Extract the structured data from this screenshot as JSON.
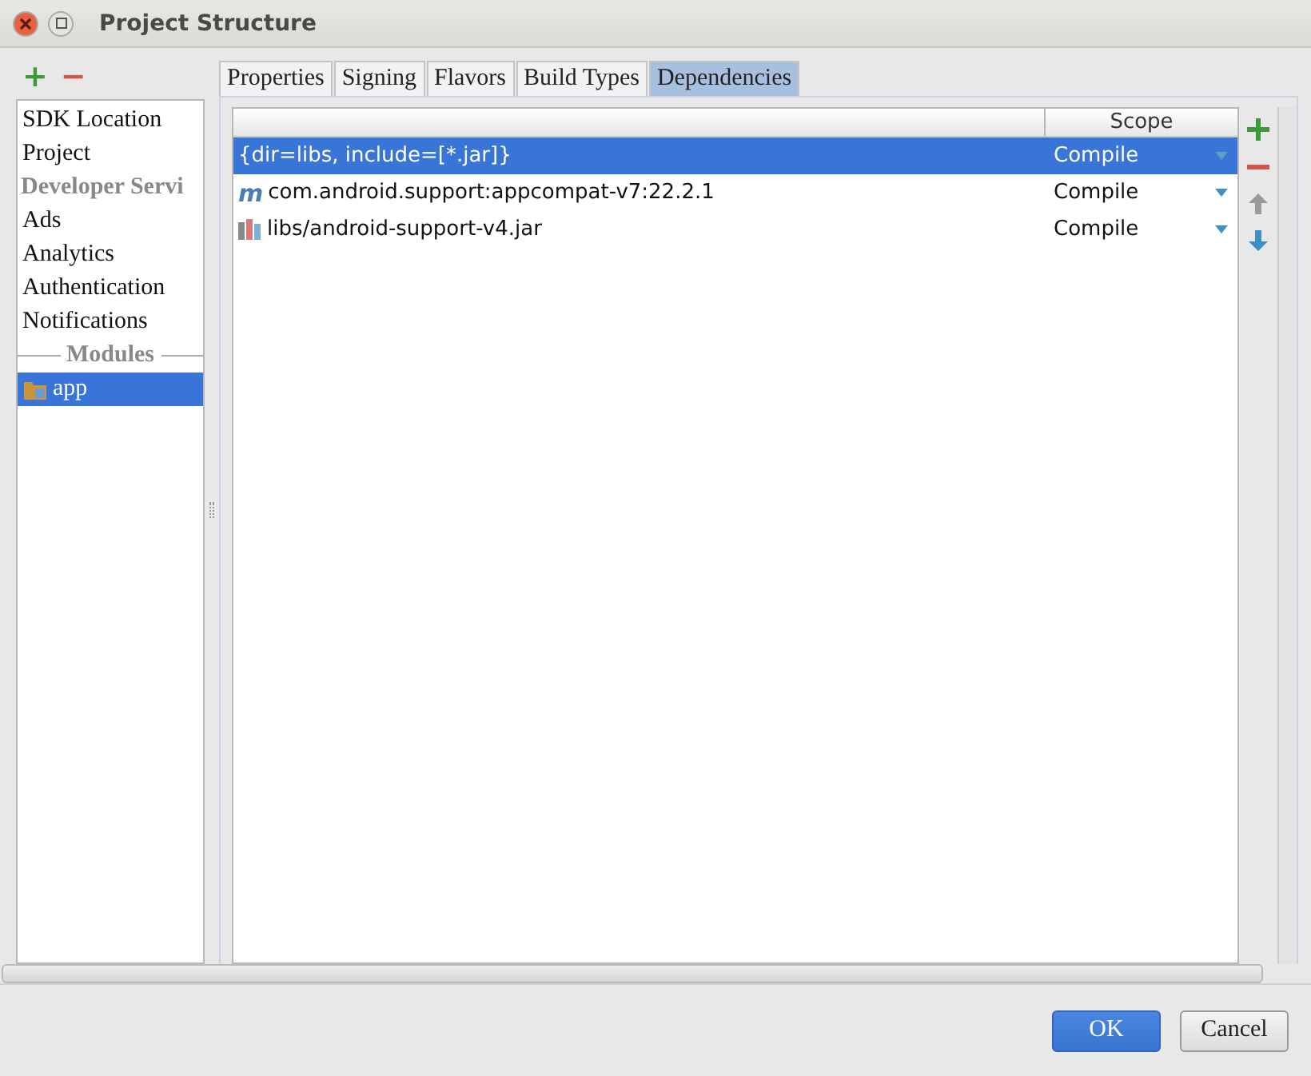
{
  "window": {
    "title": "Project Structure"
  },
  "sidebar_toolbar": {
    "add": "+",
    "remove": "−"
  },
  "sidebar": {
    "items": [
      {
        "kind": "item",
        "label": "SDK Location",
        "selected": false
      },
      {
        "kind": "item",
        "label": "Project",
        "selected": false
      },
      {
        "kind": "header",
        "label": "Developer Servi"
      },
      {
        "kind": "item",
        "label": "Ads",
        "selected": false
      },
      {
        "kind": "item",
        "label": "Analytics",
        "selected": false
      },
      {
        "kind": "item",
        "label": "Authentication",
        "selected": false
      },
      {
        "kind": "item",
        "label": "Notifications",
        "selected": false
      },
      {
        "kind": "separator",
        "label": "Modules"
      },
      {
        "kind": "module",
        "label": "app",
        "selected": true
      }
    ]
  },
  "tabs": [
    {
      "label": "Properties",
      "selected": false
    },
    {
      "label": "Signing",
      "selected": false
    },
    {
      "label": "Flavors",
      "selected": false
    },
    {
      "label": "Build Types",
      "selected": false
    },
    {
      "label": "Dependencies",
      "selected": true
    }
  ],
  "table": {
    "columns": [
      "Scope"
    ],
    "rows": [
      {
        "kind": "file",
        "name": "{dir=libs, include=[*.jar]}",
        "scope": "Compile",
        "selected": true
      },
      {
        "kind": "maven",
        "icon": "m",
        "name": "com.android.support:appcompat-v7:22.2.1",
        "scope": "Compile",
        "selected": false
      },
      {
        "kind": "jar",
        "name": "libs/android-support-v4.jar",
        "scope": "Compile",
        "selected": false
      }
    ]
  },
  "table_toolbar": [
    {
      "kind": "add",
      "disabled": false
    },
    {
      "kind": "remove",
      "disabled": false
    },
    {
      "kind": "up",
      "disabled": true
    },
    {
      "kind": "down",
      "disabled": false
    }
  ],
  "buttons": [
    {
      "label": "OK",
      "default": true
    },
    {
      "label": "Cancel",
      "default": false
    }
  ]
}
